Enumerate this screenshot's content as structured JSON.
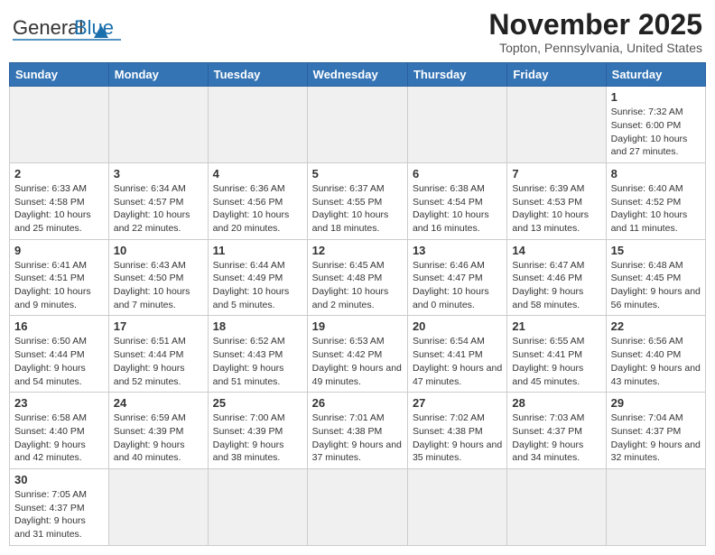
{
  "header": {
    "logo_general": "General",
    "logo_blue": "Blue",
    "month_title": "November 2025",
    "subtitle": "Topton, Pennsylvania, United States"
  },
  "weekdays": [
    "Sunday",
    "Monday",
    "Tuesday",
    "Wednesday",
    "Thursday",
    "Friday",
    "Saturday"
  ],
  "weeks": [
    [
      {
        "day": "",
        "info": ""
      },
      {
        "day": "",
        "info": ""
      },
      {
        "day": "",
        "info": ""
      },
      {
        "day": "",
        "info": ""
      },
      {
        "day": "",
        "info": ""
      },
      {
        "day": "",
        "info": ""
      },
      {
        "day": "1",
        "info": "Sunrise: 7:32 AM\nSunset: 6:00 PM\nDaylight: 10 hours and 27 minutes."
      }
    ],
    [
      {
        "day": "2",
        "info": "Sunrise: 6:33 AM\nSunset: 4:58 PM\nDaylight: 10 hours and 25 minutes."
      },
      {
        "day": "3",
        "info": "Sunrise: 6:34 AM\nSunset: 4:57 PM\nDaylight: 10 hours and 22 minutes."
      },
      {
        "day": "4",
        "info": "Sunrise: 6:36 AM\nSunset: 4:56 PM\nDaylight: 10 hours and 20 minutes."
      },
      {
        "day": "5",
        "info": "Sunrise: 6:37 AM\nSunset: 4:55 PM\nDaylight: 10 hours and 18 minutes."
      },
      {
        "day": "6",
        "info": "Sunrise: 6:38 AM\nSunset: 4:54 PM\nDaylight: 10 hours and 16 minutes."
      },
      {
        "day": "7",
        "info": "Sunrise: 6:39 AM\nSunset: 4:53 PM\nDaylight: 10 hours and 13 minutes."
      },
      {
        "day": "8",
        "info": "Sunrise: 6:40 AM\nSunset: 4:52 PM\nDaylight: 10 hours and 11 minutes."
      }
    ],
    [
      {
        "day": "9",
        "info": "Sunrise: 6:41 AM\nSunset: 4:51 PM\nDaylight: 10 hours and 9 minutes."
      },
      {
        "day": "10",
        "info": "Sunrise: 6:43 AM\nSunset: 4:50 PM\nDaylight: 10 hours and 7 minutes."
      },
      {
        "day": "11",
        "info": "Sunrise: 6:44 AM\nSunset: 4:49 PM\nDaylight: 10 hours and 5 minutes."
      },
      {
        "day": "12",
        "info": "Sunrise: 6:45 AM\nSunset: 4:48 PM\nDaylight: 10 hours and 2 minutes."
      },
      {
        "day": "13",
        "info": "Sunrise: 6:46 AM\nSunset: 4:47 PM\nDaylight: 10 hours and 0 minutes."
      },
      {
        "day": "14",
        "info": "Sunrise: 6:47 AM\nSunset: 4:46 PM\nDaylight: 9 hours and 58 minutes."
      },
      {
        "day": "15",
        "info": "Sunrise: 6:48 AM\nSunset: 4:45 PM\nDaylight: 9 hours and 56 minutes."
      }
    ],
    [
      {
        "day": "16",
        "info": "Sunrise: 6:50 AM\nSunset: 4:44 PM\nDaylight: 9 hours and 54 minutes."
      },
      {
        "day": "17",
        "info": "Sunrise: 6:51 AM\nSunset: 4:44 PM\nDaylight: 9 hours and 52 minutes."
      },
      {
        "day": "18",
        "info": "Sunrise: 6:52 AM\nSunset: 4:43 PM\nDaylight: 9 hours and 51 minutes."
      },
      {
        "day": "19",
        "info": "Sunrise: 6:53 AM\nSunset: 4:42 PM\nDaylight: 9 hours and 49 minutes."
      },
      {
        "day": "20",
        "info": "Sunrise: 6:54 AM\nSunset: 4:41 PM\nDaylight: 9 hours and 47 minutes."
      },
      {
        "day": "21",
        "info": "Sunrise: 6:55 AM\nSunset: 4:41 PM\nDaylight: 9 hours and 45 minutes."
      },
      {
        "day": "22",
        "info": "Sunrise: 6:56 AM\nSunset: 4:40 PM\nDaylight: 9 hours and 43 minutes."
      }
    ],
    [
      {
        "day": "23",
        "info": "Sunrise: 6:58 AM\nSunset: 4:40 PM\nDaylight: 9 hours and 42 minutes."
      },
      {
        "day": "24",
        "info": "Sunrise: 6:59 AM\nSunset: 4:39 PM\nDaylight: 9 hours and 40 minutes."
      },
      {
        "day": "25",
        "info": "Sunrise: 7:00 AM\nSunset: 4:39 PM\nDaylight: 9 hours and 38 minutes."
      },
      {
        "day": "26",
        "info": "Sunrise: 7:01 AM\nSunset: 4:38 PM\nDaylight: 9 hours and 37 minutes."
      },
      {
        "day": "27",
        "info": "Sunrise: 7:02 AM\nSunset: 4:38 PM\nDaylight: 9 hours and 35 minutes."
      },
      {
        "day": "28",
        "info": "Sunrise: 7:03 AM\nSunset: 4:37 PM\nDaylight: 9 hours and 34 minutes."
      },
      {
        "day": "29",
        "info": "Sunrise: 7:04 AM\nSunset: 4:37 PM\nDaylight: 9 hours and 32 minutes."
      }
    ],
    [
      {
        "day": "30",
        "info": "Sunrise: 7:05 AM\nSunset: 4:37 PM\nDaylight: 9 hours and 31 minutes."
      },
      {
        "day": "",
        "info": ""
      },
      {
        "day": "",
        "info": ""
      },
      {
        "day": "",
        "info": ""
      },
      {
        "day": "",
        "info": ""
      },
      {
        "day": "",
        "info": ""
      },
      {
        "day": "",
        "info": ""
      }
    ]
  ]
}
